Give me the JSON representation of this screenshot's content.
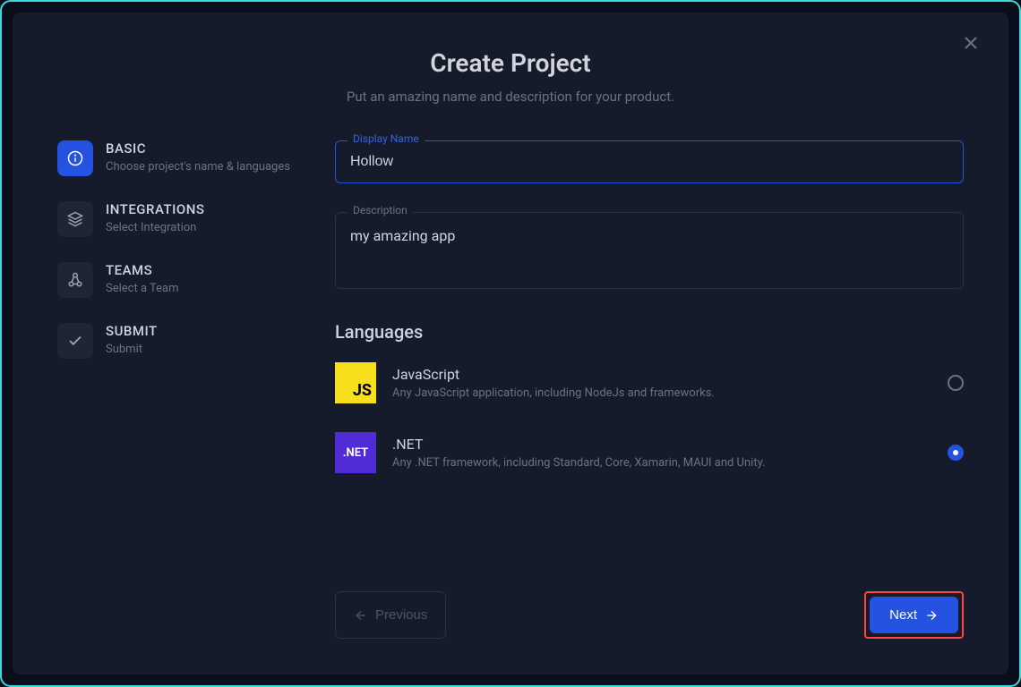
{
  "header": {
    "title": "Create Project",
    "subtitle": "Put an amazing name and description for your product."
  },
  "steps": [
    {
      "title": "BASIC",
      "desc": "Choose project's name & languages",
      "icon": "info",
      "active": true
    },
    {
      "title": "INTEGRATIONS",
      "desc": "Select Integration",
      "icon": "layers",
      "active": false
    },
    {
      "title": "TEAMS",
      "desc": "Select a Team",
      "icon": "nodes",
      "active": false
    },
    {
      "title": "SUBMIT",
      "desc": "Submit",
      "icon": "check",
      "active": false
    }
  ],
  "form": {
    "display_name_label": "Display Name",
    "display_name_value": "Hollow",
    "description_label": "Description",
    "description_value": "my amazing app"
  },
  "languages": {
    "section_title": "Languages",
    "items": [
      {
        "name": "JavaScript",
        "desc": "Any JavaScript application, including NodeJs and frameworks.",
        "icon_text": "JS",
        "selected": false
      },
      {
        "name": ".NET",
        "desc": "Any .NET framework, including Standard, Core, Xamarin, MAUI and Unity.",
        "icon_text": ".NET",
        "selected": true
      }
    ]
  },
  "buttons": {
    "previous": "Previous",
    "next": "Next"
  }
}
